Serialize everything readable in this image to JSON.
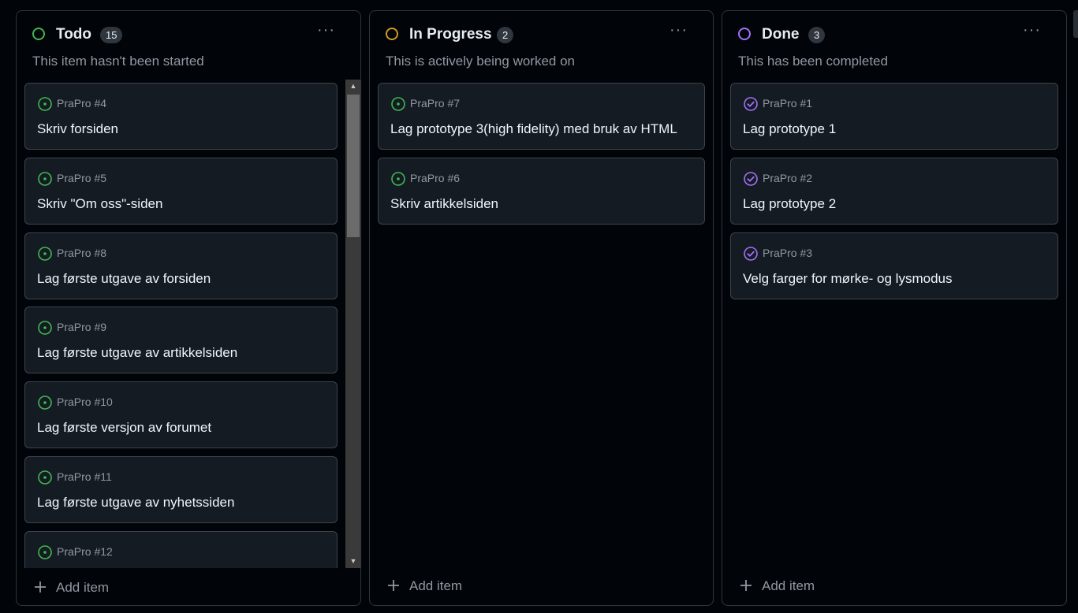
{
  "columns": [
    {
      "title": "Todo",
      "count": "15",
      "description": "This item hasn't been started",
      "status_color": "#3fb950",
      "add_label": "Add item",
      "menu_label": "···",
      "cards": [
        {
          "ref": "PraPro #4",
          "title": "Skriv forsiden",
          "icon": "issue-open-icon"
        },
        {
          "ref": "PraPro #5",
          "title": "Skriv \"Om oss\"-siden",
          "icon": "issue-open-icon"
        },
        {
          "ref": "PraPro #8",
          "title": "Lag første utgave av forsiden",
          "icon": "issue-open-icon"
        },
        {
          "ref": "PraPro #9",
          "title": "Lag første utgave av artikkelsiden",
          "icon": "issue-open-icon"
        },
        {
          "ref": "PraPro #10",
          "title": "Lag første versjon av forumet",
          "icon": "issue-open-icon"
        },
        {
          "ref": "PraPro #11",
          "title": "Lag første utgave av nyhetssiden",
          "icon": "issue-open-icon"
        },
        {
          "ref": "PraPro #12",
          "title": "",
          "icon": "issue-open-icon"
        }
      ]
    },
    {
      "title": "In Progress",
      "count": "2",
      "description": "This is actively being worked on",
      "status_color": "#d29922",
      "add_label": "Add item",
      "menu_label": "···",
      "cards": [
        {
          "ref": "PraPro #7",
          "title": "Lag prototype 3(high fidelity) med bruk av HTML",
          "icon": "issue-open-icon"
        },
        {
          "ref": "PraPro #6",
          "title": "Skriv artikkelsiden",
          "icon": "issue-open-icon"
        }
      ]
    },
    {
      "title": "Done",
      "count": "3",
      "description": "This has been completed",
      "status_color": "#a371f7",
      "add_label": "Add item",
      "menu_label": "···",
      "cards": [
        {
          "ref": "PraPro #1",
          "title": "Lag prototype 1",
          "icon": "issue-closed-icon"
        },
        {
          "ref": "PraPro #2",
          "title": "Lag prototype 2",
          "icon": "issue-closed-icon"
        },
        {
          "ref": "PraPro #3",
          "title": "Velg farger for mørke- og lysmodus",
          "icon": "issue-closed-icon"
        }
      ]
    }
  ],
  "colors": {
    "open": "#3fb950",
    "closed": "#a371f7"
  }
}
